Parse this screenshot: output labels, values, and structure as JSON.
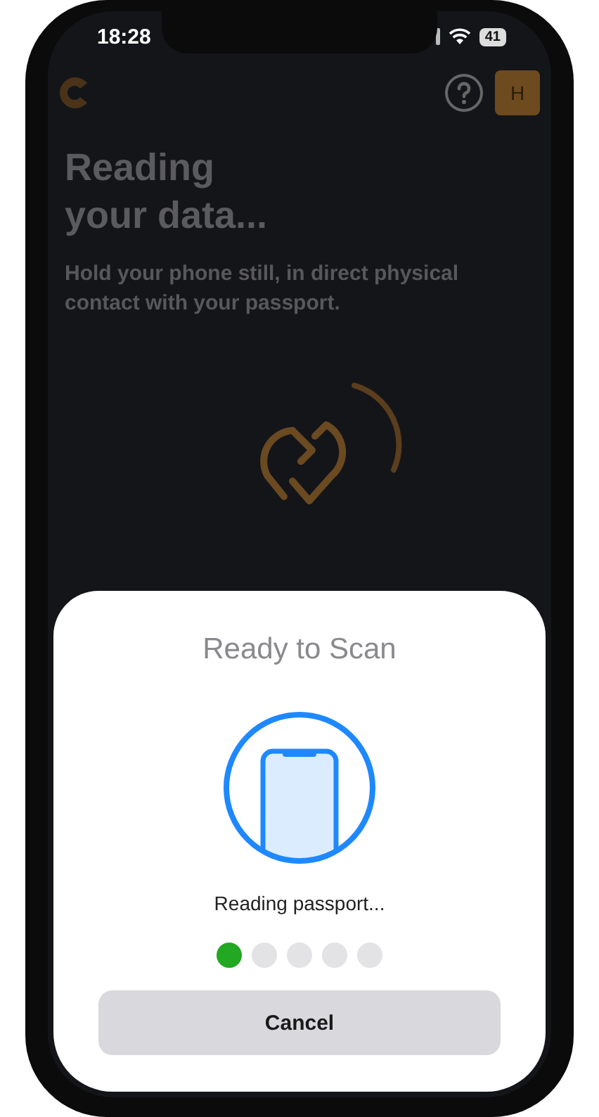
{
  "status_bar": {
    "time": "18:28",
    "battery": "41"
  },
  "header": {
    "avatar": "H"
  },
  "title": "Reading your data...",
  "subtitle": "Hold your phone still, in direct physical contact with your passport.",
  "nfc_sheet": {
    "title": "Ready to Scan",
    "message": "Reading passport...",
    "steps": [
      {
        "done": true
      },
      {
        "done": false
      },
      {
        "done": false
      },
      {
        "done": false
      },
      {
        "done": false
      }
    ],
    "button": "Cancel"
  }
}
